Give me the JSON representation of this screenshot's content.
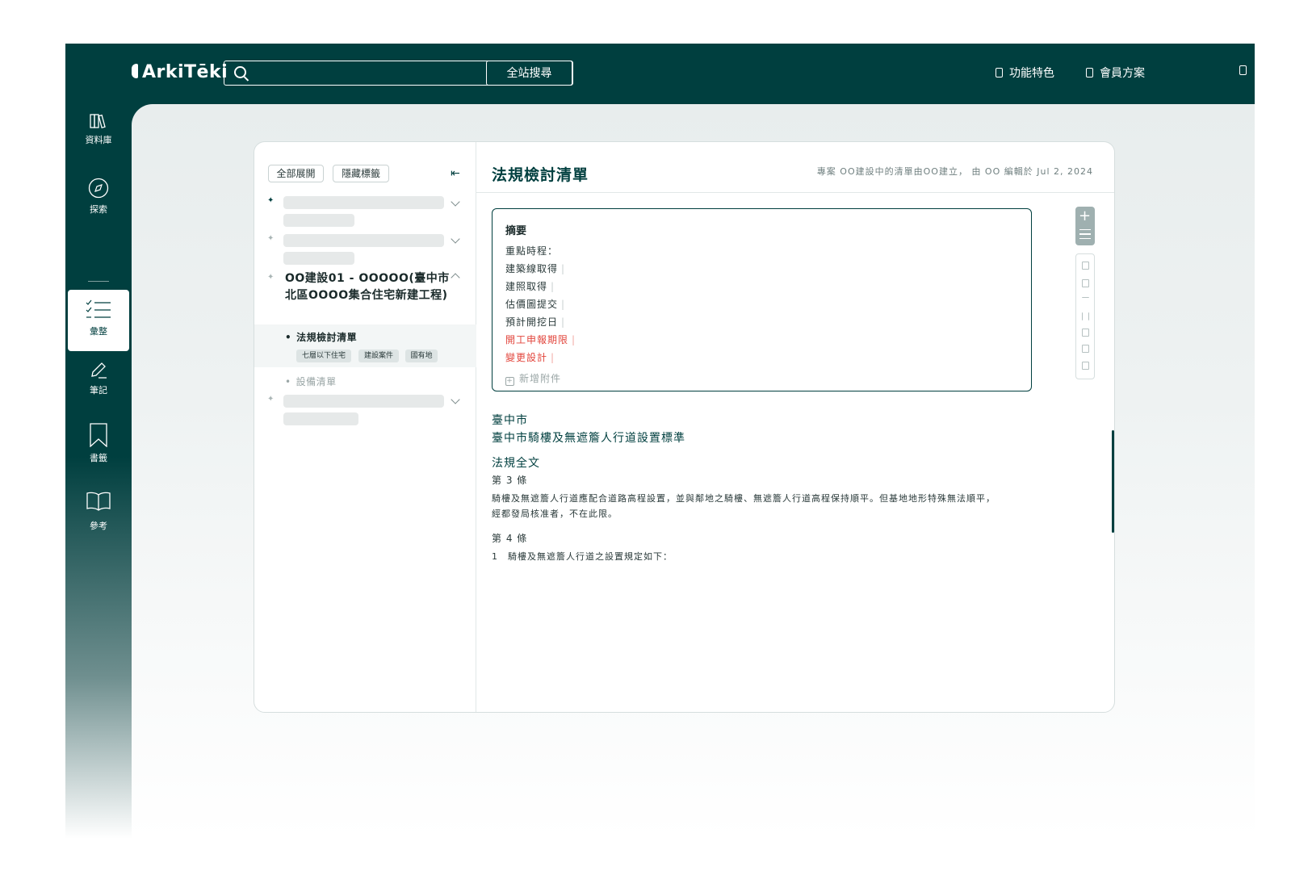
{
  "header": {
    "logo": "ArkiTēki",
    "search": {
      "placeholder": "",
      "button_label": "全站搜尋"
    },
    "nav": [
      {
        "label": "功能特色",
        "icon": "rocket-icon"
      },
      {
        "label": "會員方案",
        "icon": "clipboard-icon"
      },
      {
        "label": "",
        "icon": "calendar-icon"
      }
    ]
  },
  "sidebar": {
    "items": [
      {
        "label": "資料庫",
        "icon": "library-icon"
      },
      {
        "label": "探索",
        "icon": "compass-icon"
      },
      {
        "label": "彙整",
        "icon": "checklist-icon",
        "active": true
      },
      {
        "label": "筆記",
        "icon": "pen-icon"
      },
      {
        "label": "書籤",
        "icon": "bookmark-icon"
      },
      {
        "label": "參考",
        "icon": "book-open-icon"
      }
    ]
  },
  "tree": {
    "expand_all_label": "全部展開",
    "hide_tags_label": "隱藏標籤",
    "project_title": "OO建設01 - OOOOO(臺中市北區OOOO集合住宅新建工程)",
    "selected_item": {
      "title": "法規檢討清單",
      "tags": [
        "七層以下住宅",
        "建設案件",
        "國有地"
      ]
    },
    "sub_item": "設備清單"
  },
  "document": {
    "title": "法規檢討清單",
    "meta": "專案 OO建設中的清單由OO建立， 由 OO 編輯於 Jul 2, 2024",
    "summary": {
      "heading": "摘要",
      "subheading": "重點時程：",
      "items": [
        {
          "label": "建築線取得",
          "highlight": false
        },
        {
          "label": "建照取得",
          "highlight": false
        },
        {
          "label": "估價圖提交",
          "highlight": false
        },
        {
          "label": "預計開挖日",
          "highlight": false
        },
        {
          "label": "開工申報期限",
          "highlight": true
        },
        {
          "label": "變更設計",
          "highlight": true
        }
      ],
      "add_attachment": "新增附件",
      "accent_red": "#e2453c"
    },
    "law": {
      "city": "臺中市",
      "name": "臺中市騎樓及無遮簷人行道設置標準",
      "full_text_heading": "法規全文",
      "articles": [
        {
          "title": "第 3 條",
          "body_line1": "騎樓及無遮簷人行道應配合道路高程設置，並與鄰地之騎樓、無遮簷人行道高程保持順平。但基地地形特殊無法順平，",
          "body_line2": "經都發局核准者，不在此限。"
        },
        {
          "title": "第 4 條",
          "body_line1": "1　騎樓及無遮簷人行道之設置規定如下："
        }
      ]
    }
  },
  "colors": {
    "brand": "#003f3f",
    "accent": "#e2453c"
  }
}
